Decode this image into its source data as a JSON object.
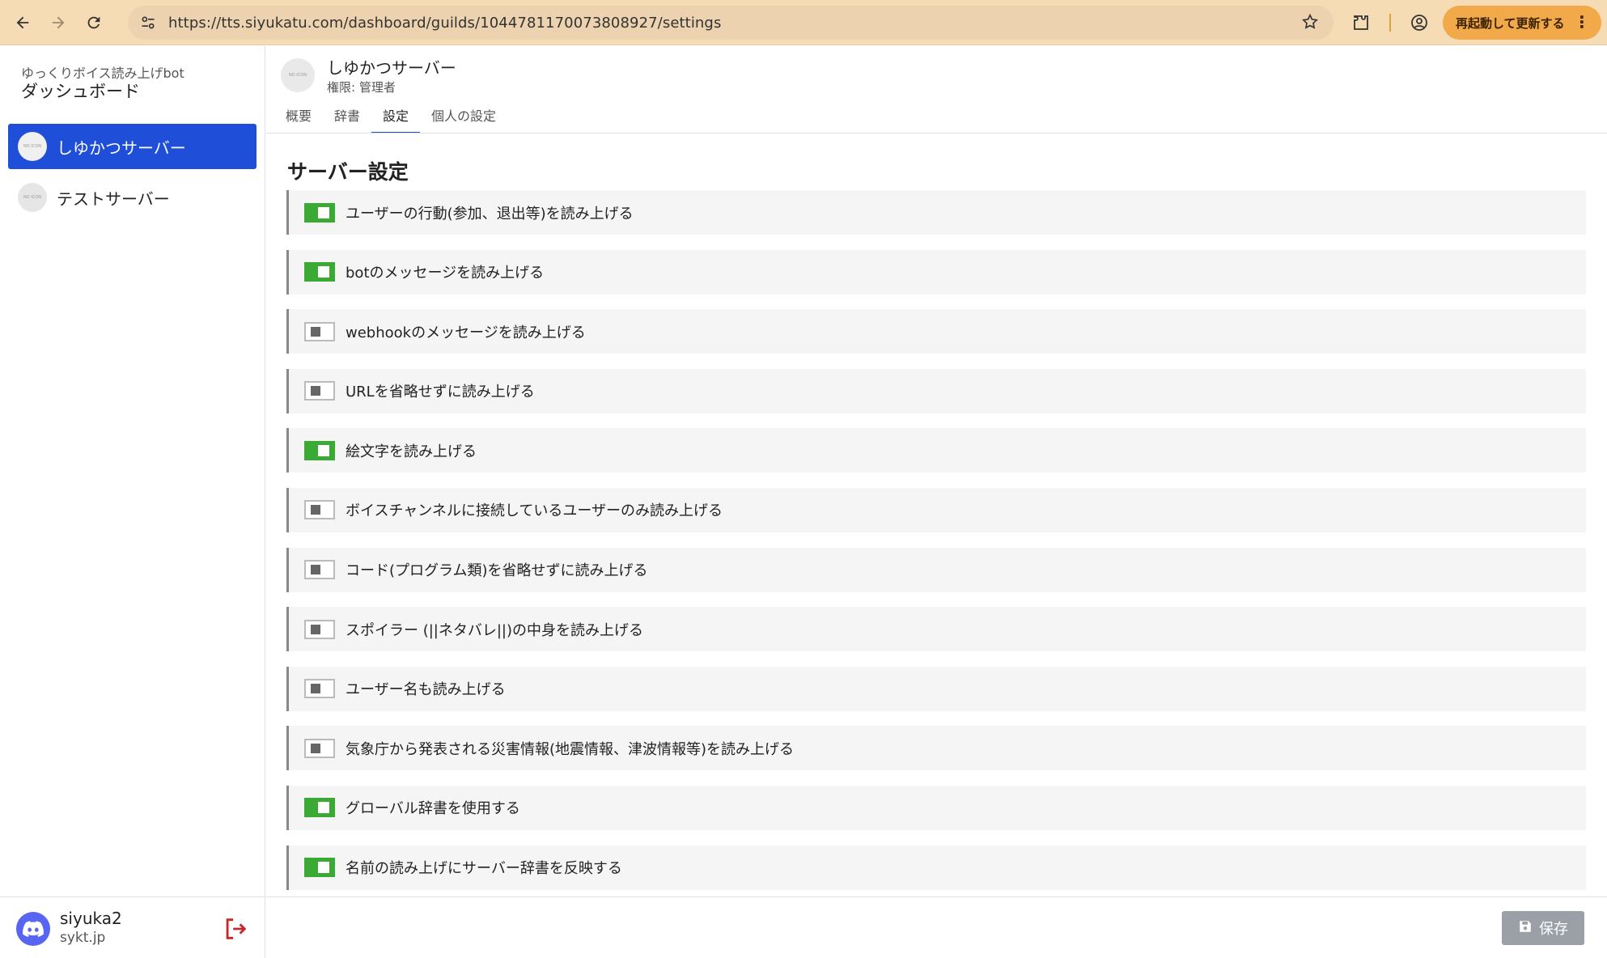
{
  "browser": {
    "url": "https://tts.siyukatu.com/dashboard/guilds/1044781170073808927/settings",
    "update_button": "再起動して更新する"
  },
  "sidebar": {
    "app_name": "ゆっくりボイス読み上げbot",
    "title": "ダッシュボード",
    "servers": [
      {
        "label": "しゆかつサーバー",
        "avatar_text": "NO ICON",
        "active": true
      },
      {
        "label": "テストサーバー",
        "avatar_text": "NO ICON",
        "active": false
      }
    ],
    "user": {
      "name": "siyuka2",
      "domain": "sykt.jp"
    }
  },
  "header": {
    "avatar_text": "NO ICON",
    "server_name": "しゆかつサーバー",
    "role": "権限: 管理者",
    "tabs": [
      "概要",
      "辞書",
      "設定",
      "個人の設定"
    ],
    "active_tab": "設定"
  },
  "settings": {
    "title": "サーバー設定",
    "items": [
      {
        "label": "ユーザーの行動(参加、退出等)を読み上げる",
        "enabled": true
      },
      {
        "label": "botのメッセージを読み上げる",
        "enabled": true
      },
      {
        "label": "webhookのメッセージを読み上げる",
        "enabled": false
      },
      {
        "label": "URLを省略せずに読み上げる",
        "enabled": false
      },
      {
        "label": "絵文字を読み上げる",
        "enabled": true
      },
      {
        "label": "ボイスチャンネルに接続しているユーザーのみ読み上げる",
        "enabled": false
      },
      {
        "label": "コード(プログラム類)を省略せずに読み上げる",
        "enabled": false
      },
      {
        "label": "スポイラー (||ネタバレ||)の中身を読み上げる",
        "enabled": false
      },
      {
        "label": "ユーザー名も読み上げる",
        "enabled": false
      },
      {
        "label": "気象庁から発表される災害情報(地震情報、津波情報等)を読み上げる",
        "enabled": false
      },
      {
        "label": "グローバル辞書を使用する",
        "enabled": true
      },
      {
        "label": "名前の読み上げにサーバー辞書を反映する",
        "enabled": true
      }
    ]
  },
  "footer": {
    "save_label": "保存"
  },
  "colors": {
    "accent": "#1f4fd8",
    "toggle_on": "#3aaa35",
    "browser_bar": "#f6dcb4",
    "update_button": "#f2a949"
  }
}
